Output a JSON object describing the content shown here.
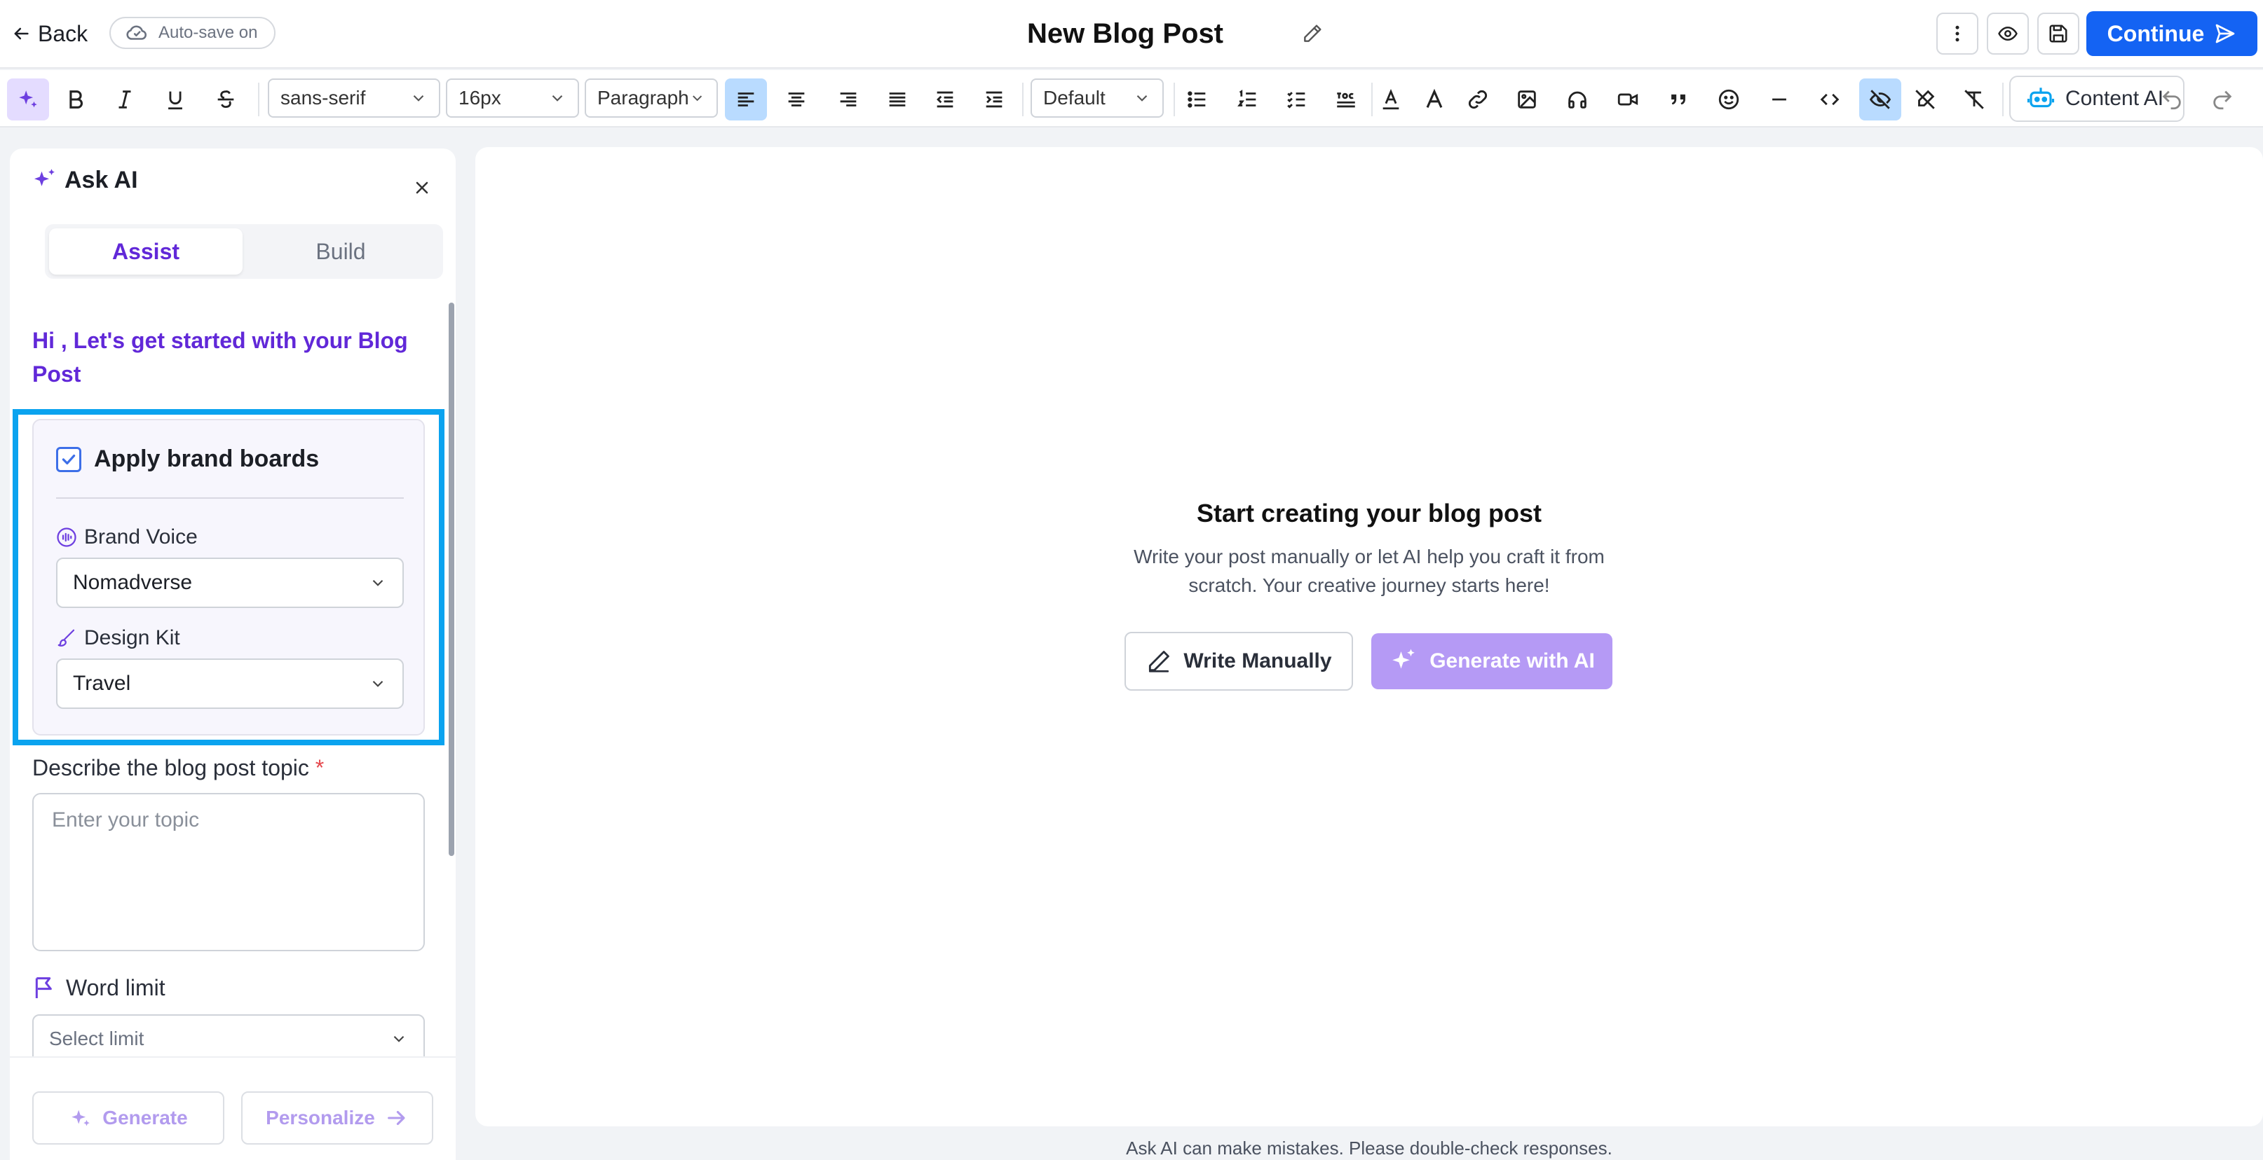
{
  "header": {
    "back_label": "Back",
    "autosave_label": "Auto-save on",
    "title": "New Blog Post",
    "continue_label": "Continue"
  },
  "toolbar": {
    "font_family": "sans-serif",
    "font_size": "16px",
    "block_style": "Paragraph",
    "text_style": "Default",
    "content_ai_label": "Content AI"
  },
  "panel": {
    "title": "Ask AI",
    "tabs": [
      "Assist",
      "Build"
    ],
    "greeting": "Hi , Let's get started with your Blog Post",
    "apply_brand_label": "Apply brand boards",
    "brand_voice_label": "Brand Voice",
    "brand_voice_value": "Nomadverse",
    "design_kit_label": "Design Kit",
    "design_kit_value": "Travel",
    "topic_label": "Describe the blog post topic",
    "required_mark": "*",
    "topic_placeholder": "Enter your topic",
    "word_limit_label": "Word limit",
    "word_limit_placeholder": "Select limit",
    "generate_label": "Generate",
    "personalize_label": "Personalize"
  },
  "canvas": {
    "empty_title": "Start creating your blog post",
    "empty_desc": "Write your post manually or let AI help you craft it from scratch. Your creative journey starts here!",
    "write_manually_label": "Write Manually",
    "generate_ai_label": "Generate with AI"
  },
  "footer": {
    "disclaimer": "Ask AI can make mistakes. Please double-check responses."
  },
  "colors": {
    "accent_purple": "#6128d8",
    "primary_blue": "#1463f3",
    "highlight_cyan": "#0aa3ef",
    "ai_button": "#b59af5"
  }
}
